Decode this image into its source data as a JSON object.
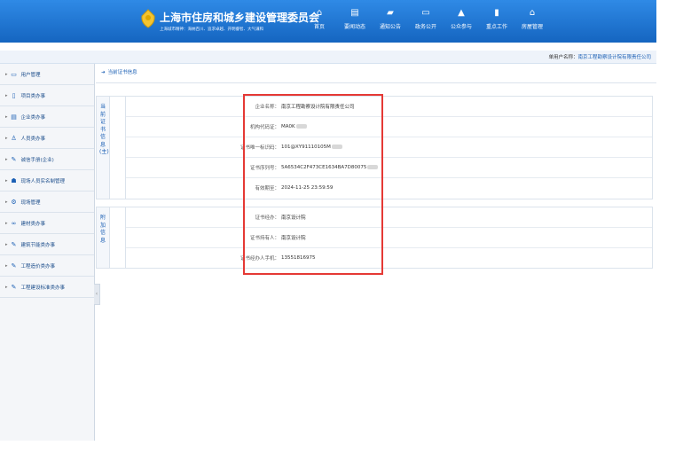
{
  "header": {
    "title": "上海市住房和城乡建设管理委员会",
    "slogan": "上海城市精神：海纳百川、追求卓越、开明睿智、大气谦和",
    "nav": [
      {
        "label": "首页",
        "icon": "home-icon",
        "glyph": "⌂"
      },
      {
        "label": "要闻动态",
        "icon": "news-icon",
        "glyph": "▤"
      },
      {
        "label": "通知公告",
        "icon": "notice-icon",
        "glyph": "▰"
      },
      {
        "label": "政务公开",
        "icon": "monitor-icon",
        "glyph": "▭"
      },
      {
        "label": "公众参与",
        "icon": "building-icon",
        "glyph": "▲"
      },
      {
        "label": "重点工作",
        "icon": "bookmark-icon",
        "glyph": "▮"
      },
      {
        "label": "房屋管理",
        "icon": "house-icon",
        "glyph": "⌂"
      }
    ]
  },
  "userbar": {
    "prefix": "单用户名称：",
    "org": "南京工程勘察设计院有限责任公司"
  },
  "sidebar": {
    "items": [
      {
        "label": "用户管理",
        "icon": "monitor-icon",
        "glyph": "▭"
      },
      {
        "label": "项目类办事",
        "icon": "file-icon",
        "glyph": "▯"
      },
      {
        "label": "企业类办事",
        "icon": "list-icon",
        "glyph": "▤"
      },
      {
        "label": "人员类办事",
        "icon": "person-icon",
        "glyph": "♙"
      },
      {
        "label": "诚信手册(企业)",
        "icon": "pen-icon",
        "glyph": "✎"
      },
      {
        "label": "现场人员实名制管理",
        "icon": "people-icon",
        "glyph": "☗"
      },
      {
        "label": "现场管理",
        "icon": "gear-icon",
        "glyph": "⚙"
      },
      {
        "label": "建材类办事",
        "icon": "link-icon",
        "glyph": "∞"
      },
      {
        "label": "建筑节能类办事",
        "icon": "wrench-icon",
        "glyph": "✎"
      },
      {
        "label": "工程造价类办事",
        "icon": "wrench-icon",
        "glyph": "✎"
      },
      {
        "label": "工程建设标准类办事",
        "icon": "wrench-icon",
        "glyph": "✎"
      }
    ]
  },
  "main": {
    "breadcrumb": "当前证书信息",
    "cert_section": {
      "heading": "当前证书信息(主)",
      "rows": [
        {
          "label": "企业名称：",
          "value": "南京工程勘察设计院有限责任公司",
          "masked": false
        },
        {
          "label": "机构代码证：",
          "value": "MA0K",
          "masked": true
        },
        {
          "label": "证书唯一标识码：",
          "value": "101@XY91110105M",
          "masked": true
        },
        {
          "label": "证书序列号：",
          "value": "5A6534C2F473CE1634BA7D80075",
          "masked": true
        },
        {
          "label": "有效期至：",
          "value": "2024-11-25 23:59:59",
          "masked": false
        }
      ]
    },
    "extra_section": {
      "heading": "附加信息",
      "rows": [
        {
          "label": "证书经办：",
          "value": "南京设计院",
          "masked": false
        },
        {
          "label": "证书持有人：",
          "value": "南京设计院",
          "masked": false
        },
        {
          "label": "证书经办人手机：",
          "value": "13551816975",
          "masked": false
        }
      ]
    }
  }
}
